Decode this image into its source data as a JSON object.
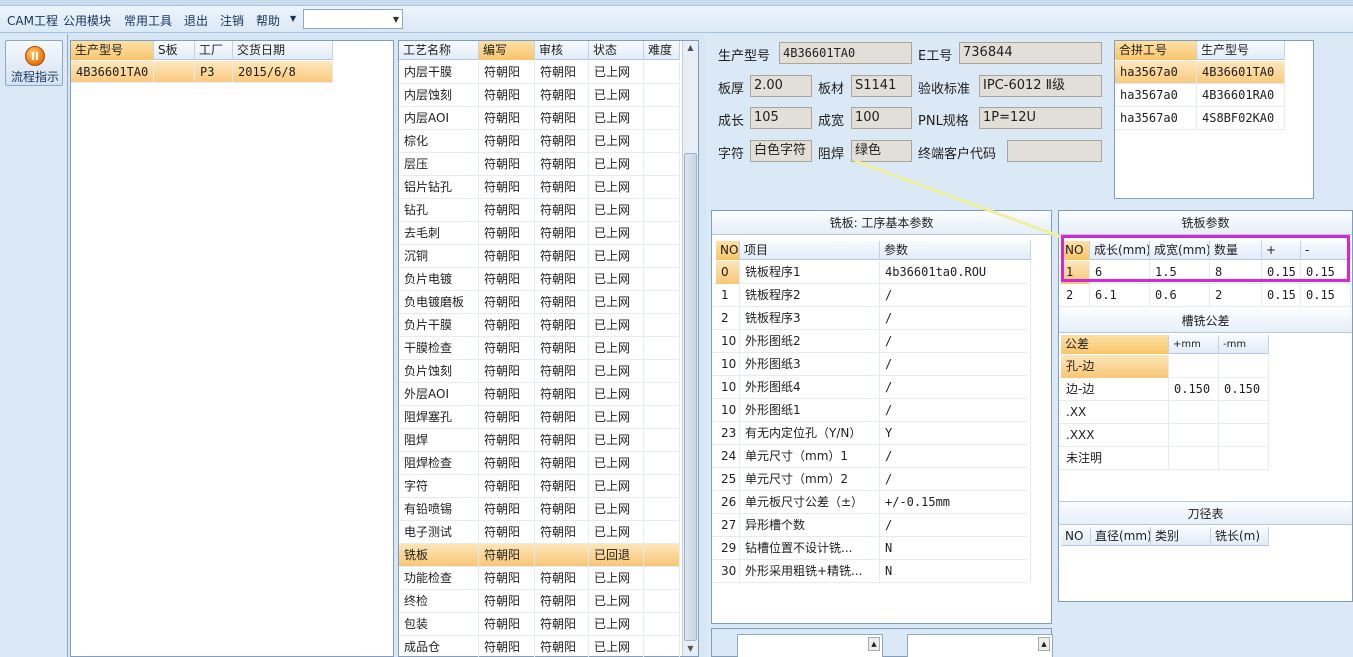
{
  "menu": [
    "CAM工程",
    "公用模块",
    "常用工具",
    "退出",
    "注销",
    "帮助"
  ],
  "menu_combo_value": "",
  "nav": {
    "flow_button": "流程指示"
  },
  "orders": {
    "headers": [
      "生产型号",
      "S板",
      "工厂",
      "交货日期"
    ],
    "rows": [
      [
        "4B36601TA0",
        "",
        "P3",
        "2015/6/8"
      ]
    ]
  },
  "process": {
    "headers": [
      "工艺名称",
      "编写",
      "审核",
      "状态",
      "难度"
    ],
    "rows": [
      [
        "内层干膜",
        "符朝阳",
        "符朝阳",
        "已上网",
        ""
      ],
      [
        "内层蚀刻",
        "符朝阳",
        "符朝阳",
        "已上网",
        ""
      ],
      [
        "内层AOI",
        "符朝阳",
        "符朝阳",
        "已上网",
        ""
      ],
      [
        "棕化",
        "符朝阳",
        "符朝阳",
        "已上网",
        ""
      ],
      [
        "层压",
        "符朝阳",
        "符朝阳",
        "已上网",
        ""
      ],
      [
        "铝片钻孔",
        "符朝阳",
        "符朝阳",
        "已上网",
        ""
      ],
      [
        "钻孔",
        "符朝阳",
        "符朝阳",
        "已上网",
        ""
      ],
      [
        "去毛刺",
        "符朝阳",
        "符朝阳",
        "已上网",
        ""
      ],
      [
        "沉铜",
        "符朝阳",
        "符朝阳",
        "已上网",
        ""
      ],
      [
        "负片电镀",
        "符朝阳",
        "符朝阳",
        "已上网",
        ""
      ],
      [
        "负电镀磨板",
        "符朝阳",
        "符朝阳",
        "已上网",
        ""
      ],
      [
        "负片干膜",
        "符朝阳",
        "符朝阳",
        "已上网",
        ""
      ],
      [
        "干膜检查",
        "符朝阳",
        "符朝阳",
        "已上网",
        ""
      ],
      [
        "负片蚀刻",
        "符朝阳",
        "符朝阳",
        "已上网",
        ""
      ],
      [
        "外层AOI",
        "符朝阳",
        "符朝阳",
        "已上网",
        ""
      ],
      [
        "阻焊塞孔",
        "符朝阳",
        "符朝阳",
        "已上网",
        ""
      ],
      [
        "阻焊",
        "符朝阳",
        "符朝阳",
        "已上网",
        ""
      ],
      [
        "阻焊检查",
        "符朝阳",
        "符朝阳",
        "已上网",
        ""
      ],
      [
        "字符",
        "符朝阳",
        "符朝阳",
        "已上网",
        ""
      ],
      [
        "有铅喷锡",
        "符朝阳",
        "符朝阳",
        "已上网",
        ""
      ],
      [
        "电子测试",
        "符朝阳",
        "符朝阳",
        "已上网",
        ""
      ],
      [
        "铣板",
        "符朝阳",
        "",
        "已回退",
        ""
      ],
      [
        "功能检查",
        "符朝阳",
        "符朝阳",
        "已上网",
        ""
      ],
      [
        "终检",
        "符朝阳",
        "符朝阳",
        "已上网",
        ""
      ],
      [
        "包装",
        "符朝阳",
        "符朝阳",
        "已上网",
        ""
      ],
      [
        "成品仓",
        "符朝阳",
        "符朝阳",
        "已上网",
        ""
      ]
    ],
    "selected_index": 21
  },
  "info": {
    "product_no_label": "生产型号",
    "product_no": "4B36601TA0",
    "e_no_label": "E工号",
    "e_no": "736844",
    "thickness_label": "板厚",
    "thickness": "2.00",
    "material_label": "板材",
    "material": "S1141",
    "standard_label": "验收标准",
    "standard": "IPC-6012 Ⅱ级",
    "length_label": "成长",
    "length": "105",
    "width_label": "成宽",
    "width": "100",
    "pnl_label": "PNL规格",
    "pnl": "1P=12U",
    "char_label": "字符",
    "char": "白色字符",
    "mask_label": "阻焊",
    "mask": "绿色",
    "client_code_label": "终端客户代码",
    "client_code": ""
  },
  "merge": {
    "headers": [
      "合拼工号",
      "生产型号"
    ],
    "rows": [
      [
        "ha3567a0",
        "4B36601TA0"
      ],
      [
        "ha3567a0",
        "4B36601RA0"
      ],
      [
        "ha3567a0",
        "4S8BF02KA0"
      ]
    ]
  },
  "routing_params": {
    "title": "铣板: 工序基本参数",
    "headers": [
      "NO",
      "项目",
      "参数"
    ],
    "rows": [
      [
        "0",
        "铣板程序1",
        "4b36601ta0.ROU"
      ],
      [
        "1",
        "铣板程序2",
        "/"
      ],
      [
        "2",
        "铣板程序3",
        "/"
      ],
      [
        "10",
        "外形图纸2",
        "/"
      ],
      [
        "10",
        "外形图纸3",
        "/"
      ],
      [
        "10",
        "外形图纸4",
        "/"
      ],
      [
        "10",
        "外形图纸1",
        "/"
      ],
      [
        "23",
        "有无内定位孔（Y/N）",
        "Y"
      ],
      [
        "24",
        "单元尺寸（mm）1",
        "/"
      ],
      [
        "25",
        "单元尺寸（mm）2",
        "/"
      ],
      [
        "26",
        "单元板尺寸公差（±）",
        "+/-0.15mm"
      ],
      [
        "27",
        "异形槽个数",
        "/"
      ],
      [
        "29",
        "钻槽位置不设计铣...",
        "N"
      ],
      [
        "30",
        "外形采用粗铣+精铣...",
        "N"
      ]
    ]
  },
  "board_params": {
    "title": "铣板参数",
    "headers": [
      "NO",
      "成长(mm)",
      "成宽(mm)",
      "数量",
      "+",
      "-"
    ],
    "rows": [
      [
        "1",
        "6",
        "1.5",
        "8",
        "0.15",
        "0.15"
      ],
      [
        "2",
        "6.1",
        "0.6",
        "2",
        "0.15",
        "0.15"
      ]
    ]
  },
  "slot_tol": {
    "title": "槽铣公差",
    "headers": [
      "公差",
      "+mm",
      "-mm"
    ],
    "rows": [
      [
        "孔-边",
        "",
        ""
      ],
      [
        "边-边",
        "0.150",
        "0.150"
      ],
      [
        ".XX",
        "",
        ""
      ],
      [
        ".XXX",
        "",
        ""
      ],
      [
        "未注明",
        "",
        ""
      ]
    ]
  },
  "tools": {
    "title": "刀径表",
    "headers": [
      "NO",
      "直径(mm)",
      "类别",
      "铣长(m)"
    ]
  },
  "colors": {
    "highlight": "#d726d6",
    "selection": "#f8c777",
    "accent": "#f07d10"
  }
}
